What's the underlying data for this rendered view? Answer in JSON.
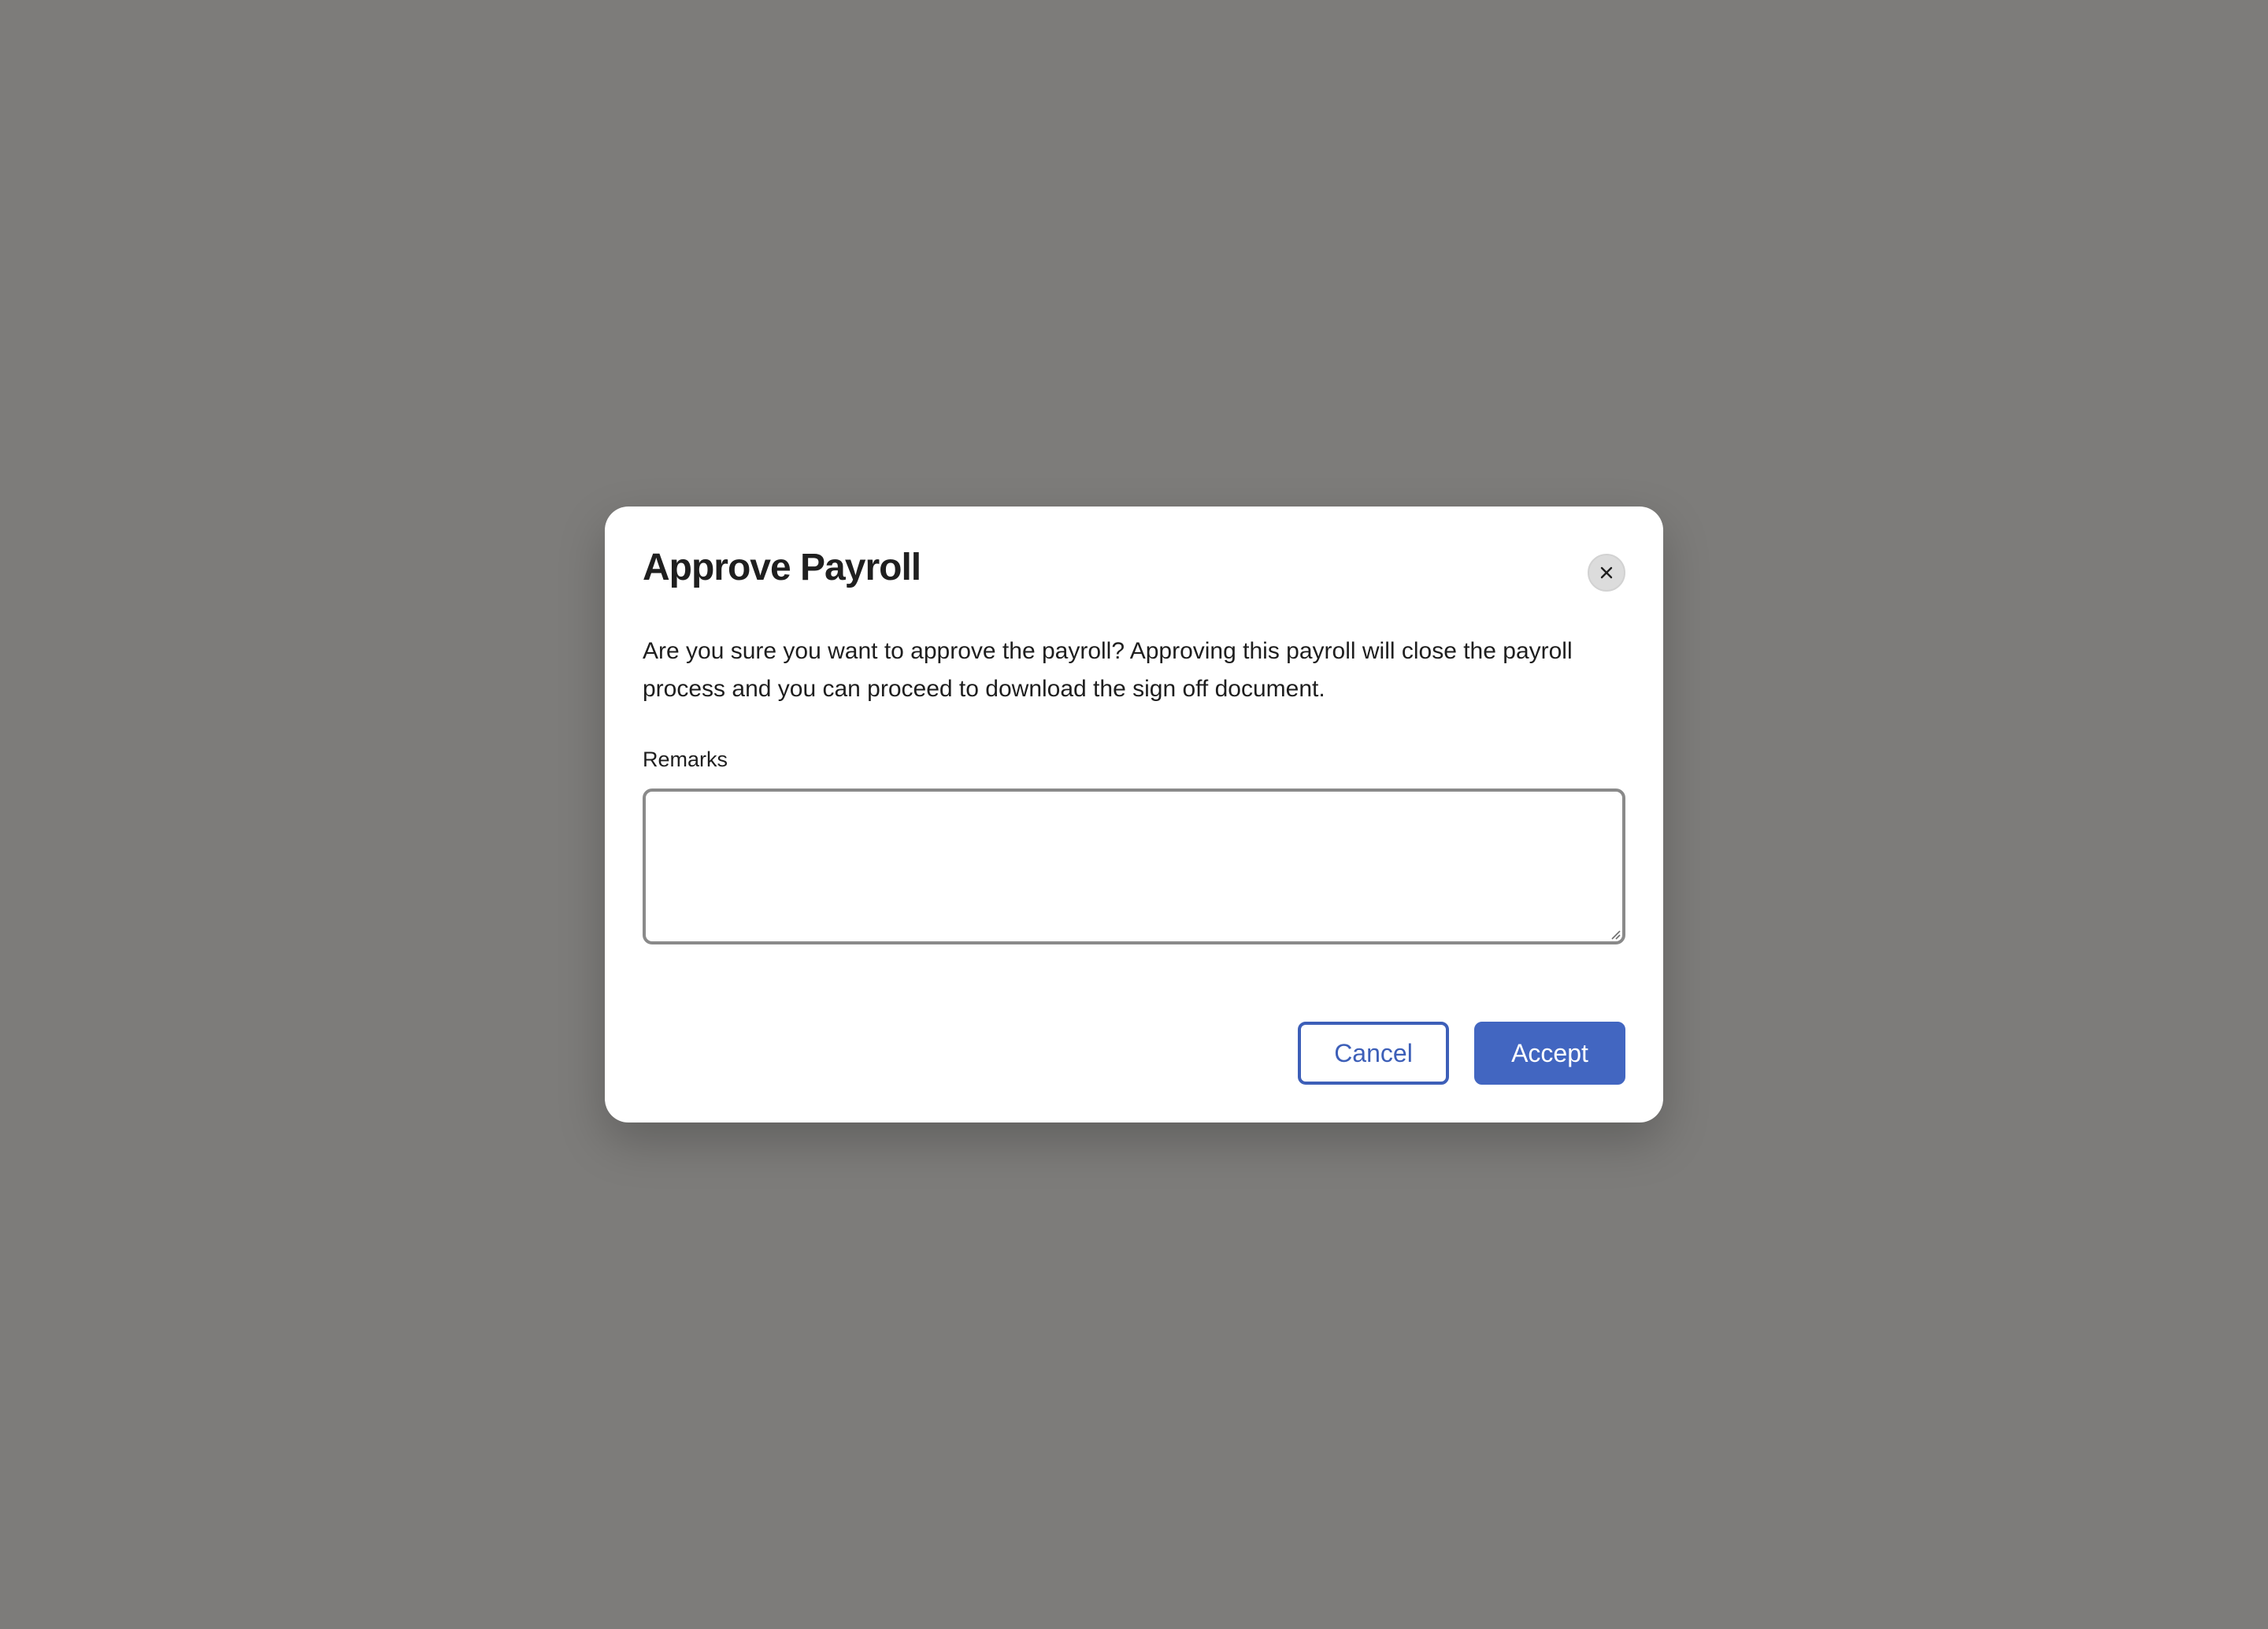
{
  "dialog": {
    "title": "Approve Payroll",
    "message": "Are you sure you want to approve the payroll? Approving this payroll will close the payroll process and you can proceed to download the sign off document.",
    "remarks_label": "Remarks",
    "remarks_value": "",
    "remarks_placeholder": "",
    "close_icon": "close-icon",
    "cancel_label": "Cancel",
    "accept_label": "Accept"
  },
  "colors": {
    "backdrop": "#7d7c7a",
    "primary": "#4266c1",
    "primary_outline": "#3d5fb8",
    "surface": "#ffffff"
  }
}
